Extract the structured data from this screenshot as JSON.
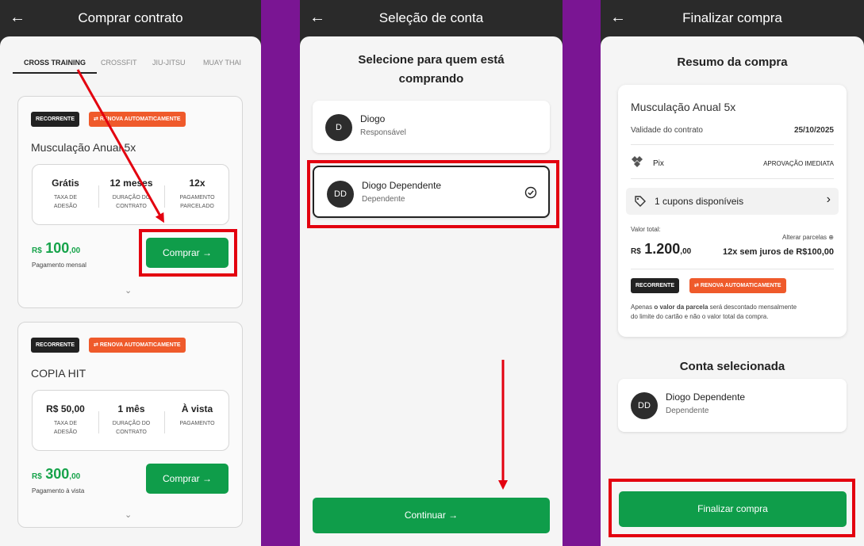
{
  "panel1": {
    "back_icon": "arrow-left-icon",
    "title": "Comprar contrato",
    "tabs": [
      "CROSS TRAINING",
      "CROSSFIT",
      "JIU-JITSU",
      "MUAY THAI"
    ],
    "plans": [
      {
        "badges": [
          "RECORRENTE",
          "RENOVA AUTOMATICAMENTE"
        ],
        "name": "Musculação Anual 5x",
        "stats": [
          {
            "value": "Grátis",
            "label1": "TAXA DE",
            "label2": "ADESÃO"
          },
          {
            "value": "12 meses",
            "label1": "DURAÇÃO DO",
            "label2": "CONTRATO"
          },
          {
            "value": "12x",
            "label1": "PAGAMENTO",
            "label2": "PARCELADO"
          }
        ],
        "currency": "R$",
        "price_int": "100",
        "price_cents": ",00",
        "price_note": "Pagamento mensal",
        "button": "Comprar →"
      },
      {
        "badges": [
          "RECORRENTE",
          "RENOVA AUTOMATICAMENTE"
        ],
        "name": "COPIA HIT",
        "stats": [
          {
            "value": "R$ 50,00",
            "label1": "TAXA DE",
            "label2": "ADESÃO"
          },
          {
            "value": "1 mês",
            "label1": "DURAÇÃO DO",
            "label2": "CONTRATO"
          },
          {
            "value": "À vista",
            "label1": "PAGAMENTO",
            "label2": ""
          }
        ],
        "currency": "R$",
        "price_int": "300",
        "price_cents": ",00",
        "price_note": "Pagamento à vista",
        "button": "Comprar →"
      }
    ]
  },
  "panel2": {
    "title": "Seleção de conta",
    "heading_line1": "Selecione para quem está",
    "heading_line2": "comprando",
    "accounts": [
      {
        "initials": "D",
        "name": "Diogo",
        "role": "Responsável"
      },
      {
        "initials": "DD",
        "name": "Diogo Dependente",
        "role": "Dependente"
      }
    ],
    "continue_button": "Continuar →"
  },
  "panel3": {
    "title": "Finalizar compra",
    "summary_heading": "Resumo da compra",
    "plan_name": "Musculação Anual 5x",
    "validity_label": "Validade do contrato",
    "validity_value": "25/10/2025",
    "payment_method": "Pix",
    "payment_status": "APROVAÇÃO IMEDIATA",
    "coupons": "1 cupons disponíveis",
    "total_label": "Valor total:",
    "change_installments": "Alterar parcelas",
    "currency": "R$",
    "total_int": "1.200",
    "total_cents": ",00",
    "installments": "12x sem juros de R$100,00",
    "badges": [
      "RECORRENTE",
      "RENOVA AUTOMATICAMENTE"
    ],
    "note_pre": "Apenas ",
    "note_bold": "o valor da parcela",
    "note_post": " será descontado mensalmente",
    "note_line2": "do limite do cartão e não o valor total da compra.",
    "account_heading": "Conta selecionada",
    "account": {
      "initials": "DD",
      "name": "Diogo Dependente",
      "role": "Dependente"
    },
    "finish_button": "Finalizar compra"
  },
  "colors": {
    "accent_green": "#0f9d4a",
    "badge_orange": "#ef5a2b",
    "highlight_red": "#e3000f",
    "background_purple": "#7a1593"
  }
}
